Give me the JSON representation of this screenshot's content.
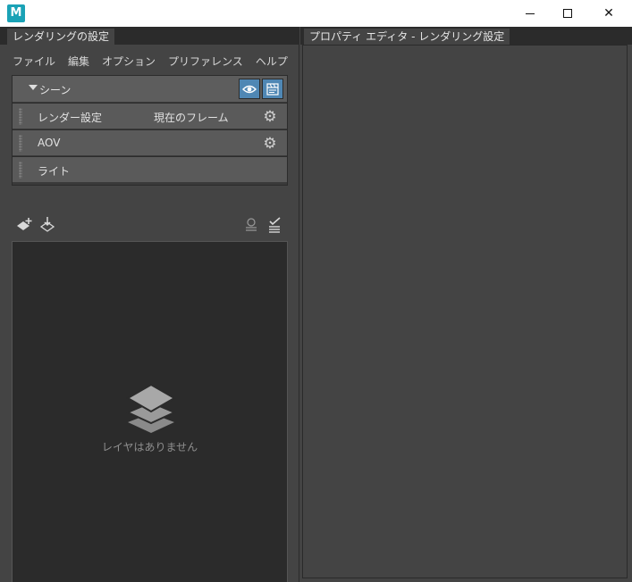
{
  "window": {
    "logo_letter": "M",
    "controls": {
      "minimize": "minimize",
      "maximize": "maximize",
      "close": "✕"
    }
  },
  "left_panel": {
    "tab_label": "レンダリングの設定",
    "menu": [
      "ファイル",
      "編集",
      "オプション",
      "プリファレンス",
      "ヘルプ"
    ],
    "scene": {
      "label": "シーン",
      "rows": [
        {
          "label": "レンダー設定",
          "value": "現在のフレーム",
          "has_gear": true
        },
        {
          "label": "AOV",
          "value": "",
          "has_gear": true
        },
        {
          "label": "ライト",
          "value": "",
          "has_gear": false
        }
      ]
    },
    "layers": {
      "empty_message": "レイヤはありません"
    }
  },
  "right_panel": {
    "tab_label": "プロパティ エディタ - レンダリング設定"
  },
  "colors": {
    "accent_button": "#4f87b4",
    "panel_bg": "#444444",
    "dark_bg": "#2b2b2b"
  },
  "icons": {
    "scene_eye": "eye-icon",
    "scene_render": "clapper-icon",
    "row_gear": "gear-icon",
    "create_layer": "add-layer-icon",
    "import_layer": "import-layer-icon",
    "filter": "filter-icon",
    "checklist": "checklist-icon",
    "empty_layers": "layers-stack-icon"
  }
}
